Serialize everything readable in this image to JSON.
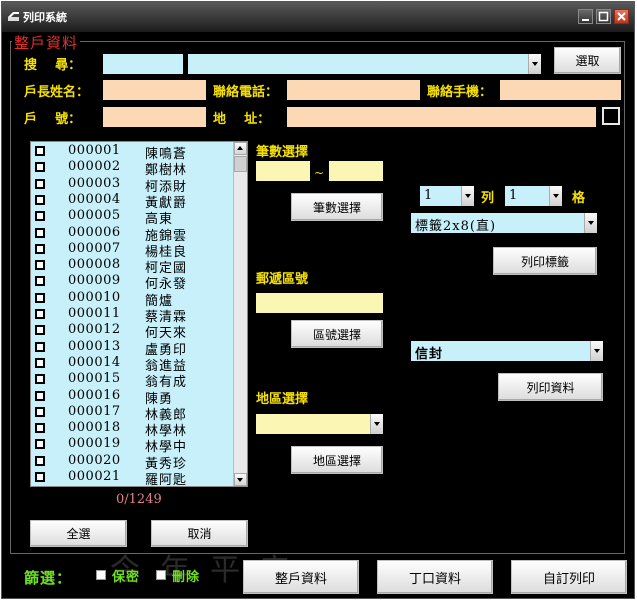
{
  "window": {
    "title": "列印系統",
    "section_title": "整戶資料"
  },
  "search": {
    "label": "搜    尋：",
    "button": "選取"
  },
  "household": {
    "head_name_label": "戶長姓名：",
    "phone_label": "聯絡電話：",
    "mobile_label": "聯絡手機：",
    "account_label": "戶    號：",
    "address_label": "地    址："
  },
  "list": {
    "items": [
      {
        "code": "000001",
        "name": "陳鳴蒼"
      },
      {
        "code": "000002",
        "name": "鄭樹林"
      },
      {
        "code": "000003",
        "name": "柯添財"
      },
      {
        "code": "000004",
        "name": "黃獻爵"
      },
      {
        "code": "000005",
        "name": "高東"
      },
      {
        "code": "000006",
        "name": "施錦雲"
      },
      {
        "code": "000007",
        "name": "楊桂良"
      },
      {
        "code": "000008",
        "name": "柯定國"
      },
      {
        "code": "000009",
        "name": "何永發"
      },
      {
        "code": "000010",
        "name": "簡爐"
      },
      {
        "code": "000011",
        "name": "蔡清霖"
      },
      {
        "code": "000012",
        "name": "何天來"
      },
      {
        "code": "000013",
        "name": "盧勇印"
      },
      {
        "code": "000014",
        "name": "翁進益"
      },
      {
        "code": "000015",
        "name": "翁有成"
      },
      {
        "code": "000016",
        "name": "陳勇"
      },
      {
        "code": "000017",
        "name": "林義郎"
      },
      {
        "code": "000018",
        "name": "林學林"
      },
      {
        "code": "000019",
        "name": "林學中"
      },
      {
        "code": "000020",
        "name": "黃秀珍"
      },
      {
        "code": "000021",
        "name": "羅阿匙"
      }
    ],
    "count": "0/1249",
    "select_all": "全選",
    "cancel": "取消"
  },
  "range": {
    "label": "筆數選擇",
    "tilde": "~",
    "button": "筆數選擇"
  },
  "postal": {
    "label": "郵遞區號",
    "button": "區號選擇"
  },
  "area": {
    "label": "地區選擇",
    "button": "地區選擇"
  },
  "label_print": {
    "col_value": "1",
    "col_label": "列",
    "row_value": "1",
    "row_label": "格",
    "format": "標籤2x8(直)",
    "button": "列印標籤"
  },
  "data_print": {
    "type": "信封",
    "button": "列印資料"
  },
  "filter": {
    "label": "篩選：",
    "confidential": "保密",
    "deleted": "刪除"
  },
  "bottom": {
    "household_data": "整戶資料",
    "member_data": "丁口資料",
    "custom_print": "自訂列印"
  },
  "watermark": "今年平安"
}
